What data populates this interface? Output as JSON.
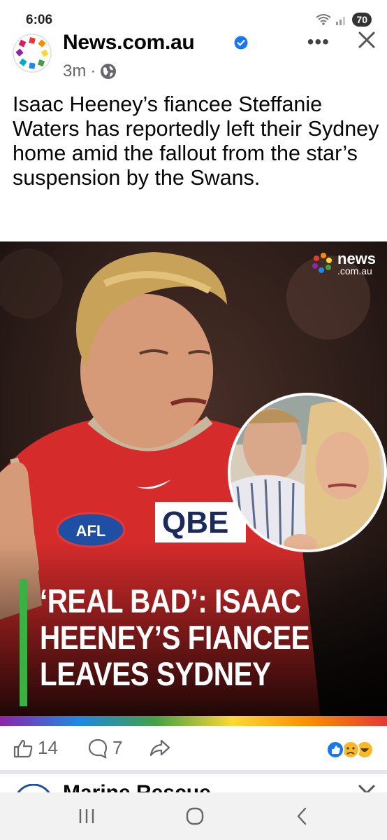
{
  "status_bar": {
    "time": "6:06",
    "battery": "70"
  },
  "post": {
    "page_name": "News.com.au",
    "time_ago": "3m",
    "separator": "·",
    "text": "Isaac Heeney’s fiancee Steffanie Waters has reportedly left their Sydney home amid the fallout from the star’s suspension by the Swans.",
    "image": {
      "brand_line1": "news",
      "brand_line2": ".com.au",
      "headline_line1": "‘REAL BAD’: ISAAC",
      "headline_line2": "HEENEY’S FIANCEE",
      "headline_line3": "LEAVES SYDNEY",
      "jersey_sponsor": "QBE",
      "jersey_badge": "AFL"
    },
    "actions": {
      "likes": "14",
      "comments": "7"
    }
  },
  "next_post": {
    "page_name": "Marine Rescue"
  },
  "icons": {
    "verified": "verified-badge-icon",
    "globe": "globe-icon",
    "more": "more-options-icon",
    "close": "close-icon",
    "like": "thumbs-up-icon",
    "comment": "comment-icon",
    "share": "share-icon"
  },
  "colors": {
    "verified_blue": "#1877f2",
    "headline_bar": "#3cb043",
    "text": "#050505",
    "meta": "#65676b"
  }
}
